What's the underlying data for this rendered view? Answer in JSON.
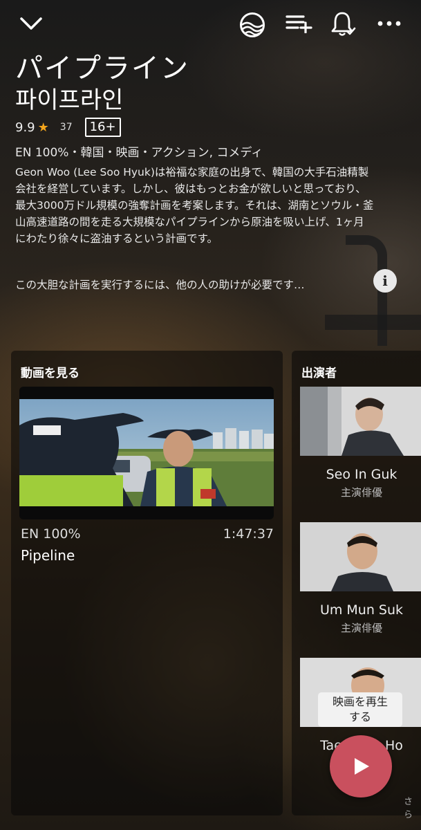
{
  "header": {
    "back_icon": "chevron-down-icon",
    "wave_icon": "wave-logo-icon",
    "add_list_icon": "playlist-add-icon",
    "bell_icon": "bell-check-icon",
    "more_icon": "more-horizontal-icon"
  },
  "title": {
    "japanese": "パイプライン",
    "korean": "파이프라인"
  },
  "meta": {
    "rating": "9.9",
    "votes": "37",
    "age_rating": "16+",
    "genres": "EN 100%・韓国・映画・アクション, コメディ"
  },
  "description": {
    "main": "Geon Woo (Lee Soo Hyuk)は裕福な家庭の出身で、韓国の大手石油精製会社を経営しています。しかし、彼はもっとお金が欲しいと思っており、最大3000万ドル規模の強奪計画を考案します。それは、湖南とソウル・釜山高速道路の間を走る大規模なパイプラインから原油を吸い上げ、1ヶ月にわたり徐々に盗油するという計画です。",
    "second": "この大胆な計画を実行するには、他の人の助けが必要です…",
    "info_label": "i"
  },
  "watch": {
    "title": "動画を見る",
    "video": {
      "language": "EN 100%",
      "duration": "1:47:37",
      "title": "Pipeline"
    }
  },
  "cast": {
    "title": "出演者",
    "members": [
      {
        "name": "Seo In Guk",
        "role": "主演俳優"
      },
      {
        "name": "Um Mun Suk",
        "role": "主演俳優"
      },
      {
        "name": "Tae Hang Ho",
        "role": ""
      }
    ],
    "more": "さら"
  },
  "tooltip": {
    "text_line1": "映画を再生",
    "text_line2": "する"
  },
  "colors": {
    "accent_star": "#f4a51c",
    "play_button": "#c9505e"
  }
}
